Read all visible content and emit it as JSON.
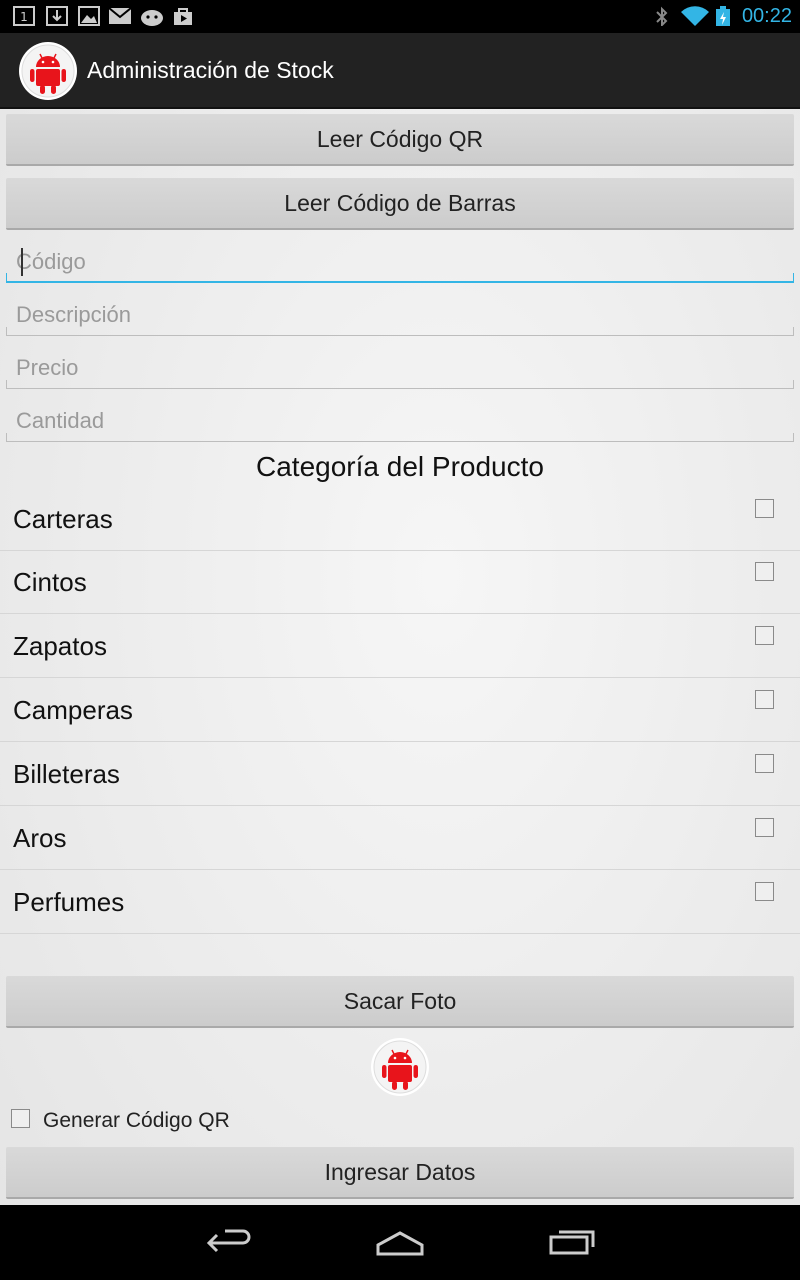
{
  "status_bar": {
    "time": "00:22",
    "icons": [
      "notification-1-icon",
      "download-icon",
      "image-icon",
      "mail-icon",
      "android-icon",
      "store-icon",
      "bluetooth-icon",
      "wifi-icon",
      "battery-charging-icon"
    ]
  },
  "action_bar": {
    "title": "Administración de Stock"
  },
  "buttons": {
    "read_qr": "Leer Código QR",
    "read_barcode": "Leer Código de Barras",
    "take_photo": "Sacar Foto",
    "submit": "Ingresar Datos"
  },
  "fields": {
    "code": {
      "placeholder": "Código",
      "value": ""
    },
    "description": {
      "placeholder": "Descripción",
      "value": ""
    },
    "price": {
      "placeholder": "Precio",
      "value": ""
    },
    "quantity": {
      "placeholder": "Cantidad",
      "value": ""
    }
  },
  "category": {
    "heading": "Categoría del Producto",
    "items": [
      {
        "label": "Carteras",
        "checked": false
      },
      {
        "label": "Cintos",
        "checked": false
      },
      {
        "label": "Zapatos",
        "checked": false
      },
      {
        "label": "Camperas",
        "checked": false
      },
      {
        "label": "Billeteras",
        "checked": false
      },
      {
        "label": "Aros",
        "checked": false
      },
      {
        "label": "Perfumes",
        "checked": false
      }
    ]
  },
  "generate_qr": {
    "label": "Generar Código QR",
    "checked": false
  },
  "colors": {
    "accent": "#33b5e5",
    "android_red": "#e8141b",
    "bar": "#222222"
  }
}
